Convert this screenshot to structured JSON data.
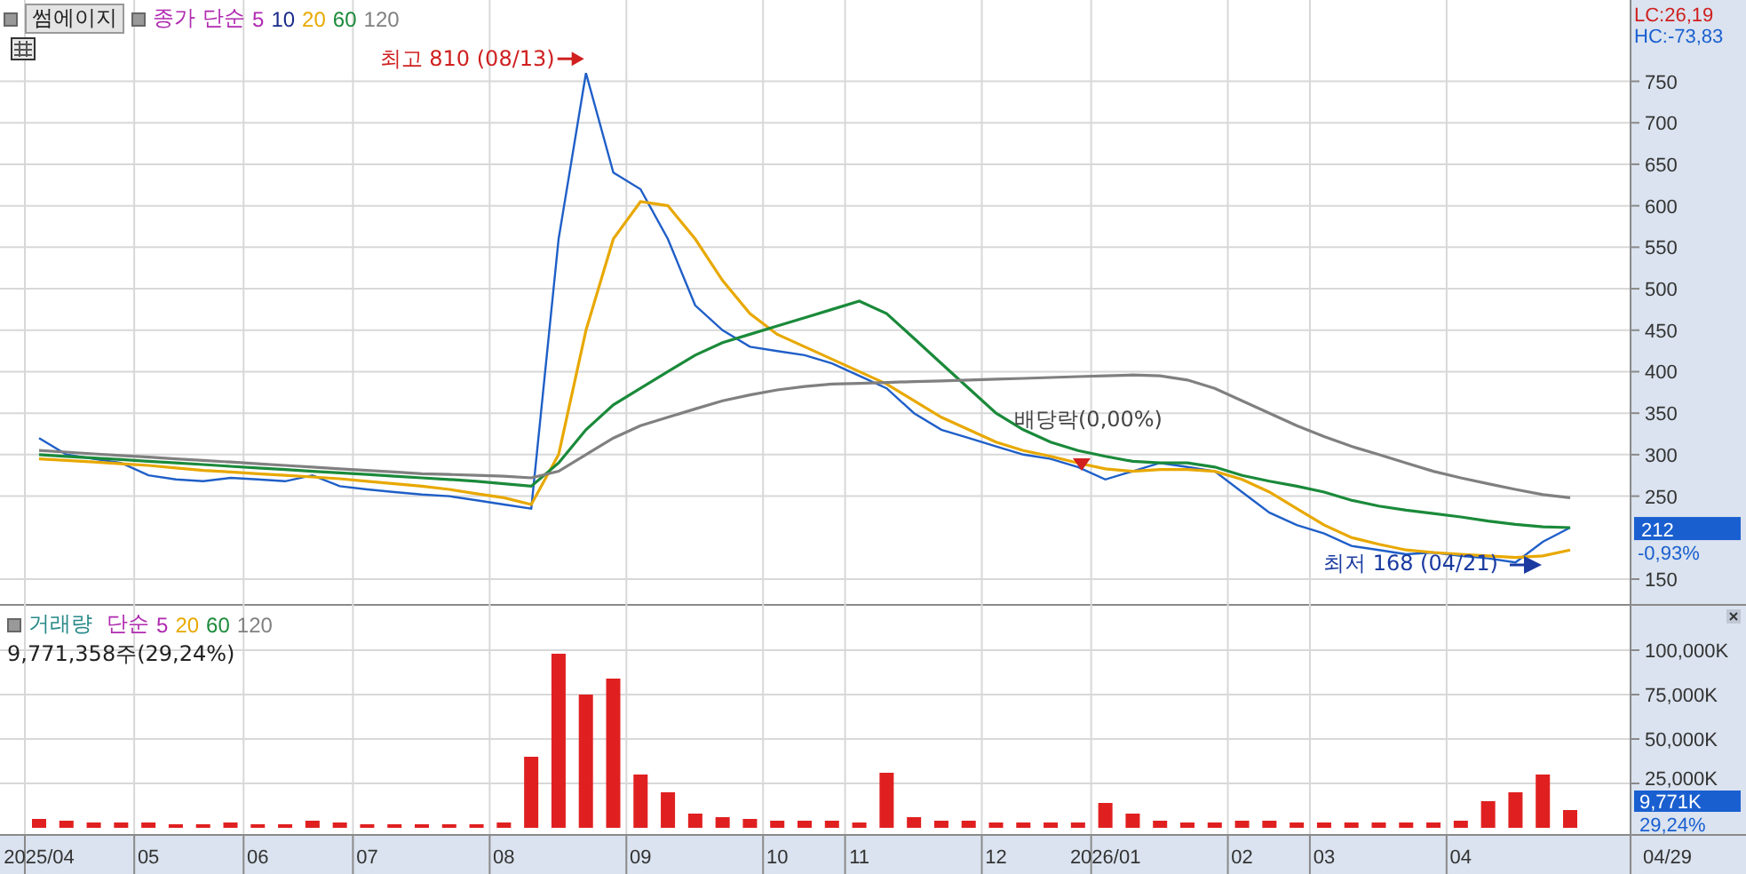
{
  "price_panel": {
    "legend": {
      "symbol": "썸에이지",
      "ma_label": "단순",
      "periods": [
        {
          "text": "5",
          "color": "#b02ab0"
        },
        {
          "text": "10",
          "color": "#1a2a8a"
        }
      ]
    },
    "annotations": [
      {
        "kind": "high",
        "text": "최고 810 (08/13)"
      },
      {
        "kind": "dividend",
        "text": "배당락(0,00%)"
      },
      {
        "kind": "low",
        "text": "최저 168 (04/21)"
      }
    ],
    "axis": {
      "lc": "LC:26,19",
      "hc": "HC:-73,83",
      "current_price": "212",
      "current_change": "-0,93%"
    },
    "chart_data": {
      "type": "line",
      "grid": true,
      "ylim": [
        120,
        848
      ],
      "yticks": [
        150,
        250,
        300,
        350,
        400,
        450,
        500,
        550,
        600,
        650,
        700,
        750
      ],
      "series": [
        {
          "name": "종가",
          "color": "#1f5fc8",
          "values": [
            320,
            300,
            295,
            290,
            275,
            270,
            268,
            272,
            270,
            268,
            275,
            262,
            258,
            255,
            252,
            250,
            245,
            240,
            235,
            560,
            760,
            640,
            620,
            560,
            480,
            450,
            430,
            425,
            420,
            410,
            395,
            380,
            350,
            330,
            320,
            310,
            300,
            295,
            285,
            270,
            280,
            290,
            285,
            280,
            255,
            230,
            215,
            205,
            190,
            185,
            180,
            182,
            178,
            175,
            170,
            195,
            212
          ]
        },
        {
          "name": "20",
          "color": "#e8a800",
          "values": [
            295,
            293,
            291,
            289,
            287,
            284,
            281,
            279,
            277,
            275,
            273,
            271,
            268,
            265,
            262,
            258,
            253,
            248,
            240,
            300,
            450,
            560,
            605,
            600,
            560,
            510,
            470,
            445,
            430,
            415,
            400,
            385,
            365,
            345,
            330,
            315,
            305,
            298,
            290,
            283,
            280,
            282,
            282,
            280,
            270,
            255,
            235,
            215,
            200,
            192,
            185,
            182,
            180,
            178,
            176,
            178,
            185
          ]
        },
        {
          "name": "60",
          "color": "#1a8a3a",
          "values": [
            300,
            298,
            296,
            294,
            292,
            290,
            288,
            286,
            284,
            282,
            280,
            278,
            276,
            274,
            272,
            270,
            268,
            265,
            262,
            290,
            330,
            360,
            380,
            400,
            420,
            435,
            445,
            455,
            465,
            475,
            485,
            470,
            440,
            410,
            380,
            350,
            330,
            315,
            305,
            298,
            292,
            290,
            290,
            285,
            275,
            268,
            262,
            255,
            245,
            238,
            233,
            229,
            225,
            220,
            216,
            213,
            212
          ]
        },
        {
          "name": "120",
          "color": "#808080",
          "values": [
            305,
            303,
            301,
            299,
            297,
            295,
            293,
            291,
            289,
            287,
            285,
            283,
            281,
            279,
            277,
            276,
            275,
            274,
            272,
            280,
            300,
            320,
            335,
            345,
            355,
            365,
            372,
            378,
            382,
            385,
            386,
            387,
            388,
            389,
            390,
            391,
            392,
            393,
            394,
            395,
            396,
            395,
            390,
            380,
            365,
            350,
            335,
            322,
            310,
            300,
            290,
            280,
            272,
            265,
            258,
            252,
            248
          ]
        }
      ]
    }
  },
  "volume_panel": {
    "legend": {
      "ma_label": "단순",
      "periods": [
        {
          "text": "5",
          "color": "#b02ab0"
        },
        {
          "text": "20",
          "color": "#e8a800"
        },
        {
          "text": "60",
          "color": "#1a8a3a"
        },
        {
          "text": "120",
          "color": "#808080"
        }
      ],
      "reading": "9,771,358주(29,24%)"
    },
    "axis": {
      "current": "9,771K",
      "ratio": "29,24%"
    },
    "chart_data": {
      "type": "bar",
      "grid": true,
      "ylim": [
        0,
        126000
      ],
      "yticks": [
        {
          "value": 25000,
          "label": "25,000K"
        },
        {
          "value": 50000,
          "label": "50,000K"
        },
        {
          "value": 75000,
          "label": "75,000K"
        },
        {
          "value": 100000,
          "label": "100,000K"
        }
      ],
      "categories": [
        "2025/04",
        null,
        null,
        null,
        "05",
        null,
        null,
        null,
        "06",
        null,
        null,
        null,
        "07",
        null,
        null,
        null,
        null,
        "08",
        null,
        null,
        null,
        null,
        "09",
        null,
        null,
        null,
        null,
        "10",
        null,
        null,
        "11",
        null,
        null,
        null,
        null,
        "12",
        null,
        null,
        null,
        "2026/01",
        null,
        null,
        null,
        null,
        "02",
        null,
        null,
        "03",
        null,
        null,
        null,
        null,
        "04",
        null,
        null,
        null,
        null
      ],
      "series": [
        {
          "name": "거래량",
          "color": "#e02020",
          "values": [
            5000,
            4000,
            3000,
            3000,
            3000,
            2000,
            2000,
            3000,
            2000,
            2000,
            4000,
            3000,
            2000,
            2000,
            2000,
            2000,
            2000,
            3000,
            40000,
            98000,
            75000,
            84000,
            30000,
            20000,
            8000,
            6000,
            5000,
            4000,
            4000,
            4000,
            3000,
            31000,
            6000,
            4000,
            4000,
            3000,
            3000,
            3000,
            3000,
            14000,
            8000,
            4000,
            3000,
            3000,
            4000,
            4000,
            3000,
            3000,
            3000,
            3000,
            3000,
            3000,
            4000,
            15000,
            20000,
            30000,
            10000
          ]
        }
      ]
    }
  },
  "date_axis": {
    "last_date": "04/29"
  }
}
